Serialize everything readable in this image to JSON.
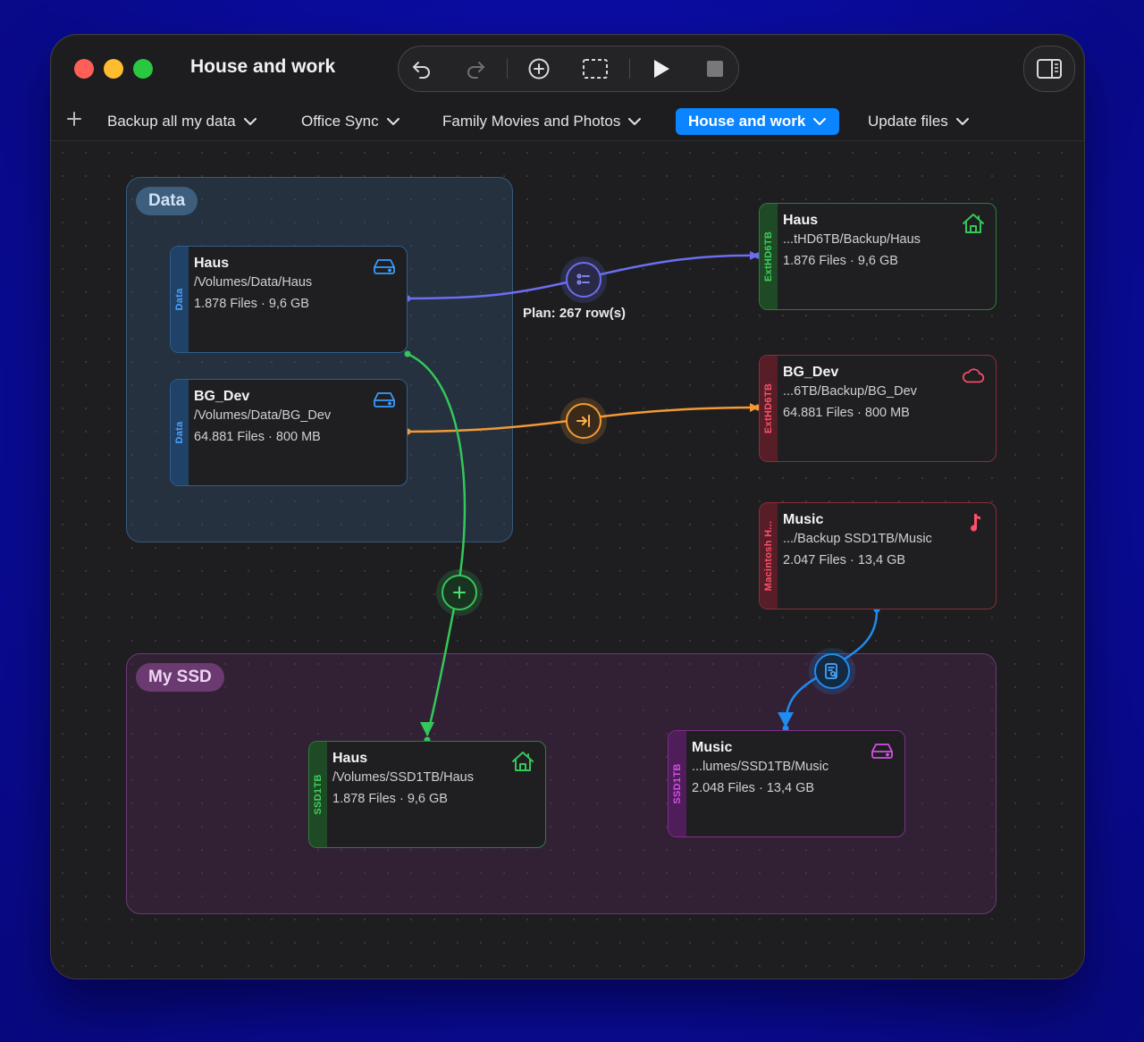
{
  "window": {
    "title": "House and work"
  },
  "toolbar": {
    "buttons": [
      {
        "name": "undo-button",
        "icon": "undo-icon"
      },
      {
        "name": "redo-button",
        "icon": "redo-icon"
      },
      {
        "name": "add-node-button",
        "icon": "plus-circle-icon"
      },
      {
        "name": "select-button",
        "icon": "dashed-rect-icon"
      },
      {
        "name": "run-button",
        "icon": "play-icon"
      },
      {
        "name": "stop-button",
        "icon": "stop-icon"
      }
    ],
    "sidebar_toggle_icon": "sidebar-icon"
  },
  "tabs": [
    {
      "label": "Backup all my data",
      "active": false
    },
    {
      "label": "Office Sync",
      "active": false
    },
    {
      "label": "Family Movies and Photos",
      "active": false
    },
    {
      "label": "House and work",
      "active": true
    },
    {
      "label": "Update files",
      "active": false
    }
  ],
  "groups": {
    "data": {
      "label": "Data",
      "color": "#3e5e7e"
    },
    "ssd": {
      "label": "My SSD",
      "color": "#6a3a70"
    }
  },
  "nodes": {
    "data_haus": {
      "name": "Haus",
      "path": "/Volumes/Data/Haus",
      "stats": "1.878 Files · 9,6 GB",
      "volume": "Data",
      "icon": "drive-icon"
    },
    "data_bgdev": {
      "name": "BG_Dev",
      "path": "/Volumes/Data/BG_Dev",
      "stats": "64.881 Files · 800 MB",
      "volume": "Data",
      "icon": "drive-icon"
    },
    "ext_haus": {
      "name": "Haus",
      "path": "...tHD6TB/Backup/Haus",
      "stats": "1.876 Files · 9,6 GB",
      "volume": "ExtHD6TB",
      "icon": "house-icon"
    },
    "ext_bgdev": {
      "name": "BG_Dev",
      "path": "...6TB/Backup/BG_Dev",
      "stats": "64.881 Files · 800 MB",
      "volume": "ExtHD6TB",
      "icon": "cloud-icon"
    },
    "mac_music": {
      "name": "Music",
      "path": ".../Backup SSD1TB/Music",
      "stats": "2.047 Files · 13,4 GB",
      "volume": "Macintosh H...",
      "icon": "music-note-icon"
    },
    "ssd_haus": {
      "name": "Haus",
      "path": "/Volumes/SSD1TB/Haus",
      "stats": "1.878 Files · 9,6 GB",
      "volume": "SSD1TB",
      "icon": "house-icon"
    },
    "ssd_music": {
      "name": "Music",
      "path": "...lumes/SSD1TB/Music",
      "stats": "2.048 Files · 13,4 GB",
      "volume": "SSD1TB",
      "icon": "drive-icon"
    }
  },
  "edges": {
    "plan_label": "Plan: 267 row(s)",
    "colors": {
      "plan": "#6b6ef0",
      "copy": "#f39a35",
      "add": "#34c759",
      "index": "#1e8cf0"
    }
  }
}
